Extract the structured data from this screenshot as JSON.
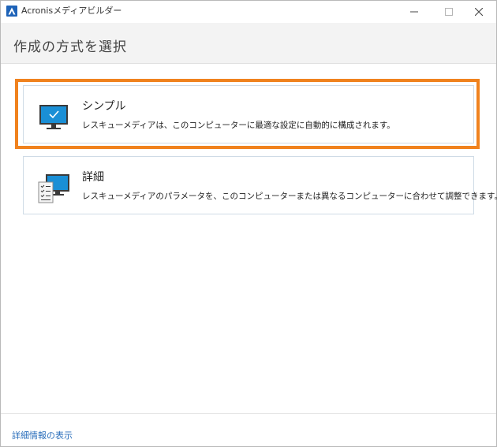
{
  "window": {
    "title": "Acronisメディアビルダー",
    "controls": {
      "minimize": "—",
      "maximize": "☐",
      "close": "✕"
    }
  },
  "header": {
    "title": "作成の方式を選択"
  },
  "options": [
    {
      "title": "シンプル",
      "description": "レスキューメディアは、このコンピューターに最適な設定に自動的に構成されます。",
      "icon": "monitor-check-icon",
      "selected": true
    },
    {
      "title": "詳細",
      "description": "レスキューメディアのパラメータを、このコンピューターまたは異なるコンピューターに合わせて調整できます。",
      "icon": "monitor-checklist-icon",
      "selected": false
    }
  ],
  "footer": {
    "details_link": "詳細情報の表示"
  },
  "colors": {
    "accent_selected": "#f0821e",
    "link": "#2a6ebb",
    "logo": "#1e63b8",
    "monitor_screen": "#1a8fd6"
  }
}
